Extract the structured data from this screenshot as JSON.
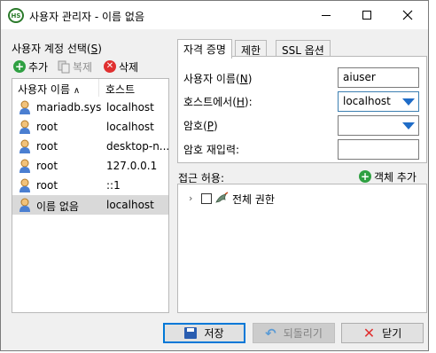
{
  "window": {
    "title": "사용자 관리자 - 이름 없음",
    "app_icon_text": "HS"
  },
  "accounts": {
    "heading": "사용자 계정 선택(S)",
    "heading_pre": "사용자 계정 선택(",
    "heading_key": "S",
    "heading_post": ")",
    "toolbar": {
      "add": "추가",
      "duplicate": "복제",
      "delete": "삭제"
    },
    "columns": {
      "username": "사용자 이름",
      "host": "호스트"
    },
    "rows": [
      {
        "user": "mariadb.sys",
        "host": "localhost"
      },
      {
        "user": "root",
        "host": "localhost"
      },
      {
        "user": "root",
        "host": "desktop-n..."
      },
      {
        "user": "root",
        "host": "127.0.0.1"
      },
      {
        "user": "root",
        "host": "::1"
      },
      {
        "user": "이름 없음",
        "host": "localhost"
      }
    ]
  },
  "tabs": {
    "credentials": "자격 증명",
    "limits": "제한",
    "ssl": "SSL 옵션"
  },
  "form": {
    "username_pre": "사용자 이름(",
    "username_key": "N",
    "username_post": ")",
    "username_value": "aiuser",
    "host_pre": "호스트에서(",
    "host_key": "H",
    "host_post": "):",
    "host_value": "localhost",
    "password_pre": "암호(",
    "password_key": "P",
    "password_post": ")",
    "password_repeat": "암호 재입력:"
  },
  "access": {
    "label": "접근 허용:",
    "add_object": "객체 추가",
    "tree_root": "전체 권한"
  },
  "buttons": {
    "save": "저장",
    "revert": "되돌리기",
    "close": "닫기"
  }
}
